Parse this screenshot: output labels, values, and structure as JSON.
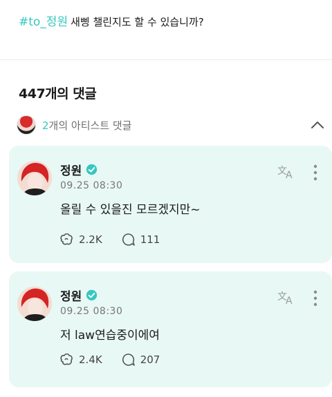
{
  "post": {
    "hashtag": "#to_정원",
    "text": "새삥 챌린지도 할 수 있습니까?"
  },
  "comments_header": {
    "title": "447개의 댓글"
  },
  "artist_comments": {
    "count": "2",
    "label": "개의 아티스트 댓글"
  },
  "comments": [
    {
      "author": "정원",
      "time": "09.25 08:30",
      "text": "올릴 수 있을진 모르겠지만~",
      "likes": "2.2K",
      "replies": "111"
    },
    {
      "author": "정원",
      "time": "09.25 08:30",
      "text": "저 law연습중이에여",
      "likes": "2.4K",
      "replies": "207"
    }
  ],
  "colors": {
    "accent": "#35c8c0",
    "card_bg": "#e8f8f5"
  },
  "icons": [
    "collapse-chevron-up-icon",
    "verified-badge-icon",
    "translate-icon",
    "more-vertical-icon",
    "like-icon",
    "reply-icon"
  ]
}
